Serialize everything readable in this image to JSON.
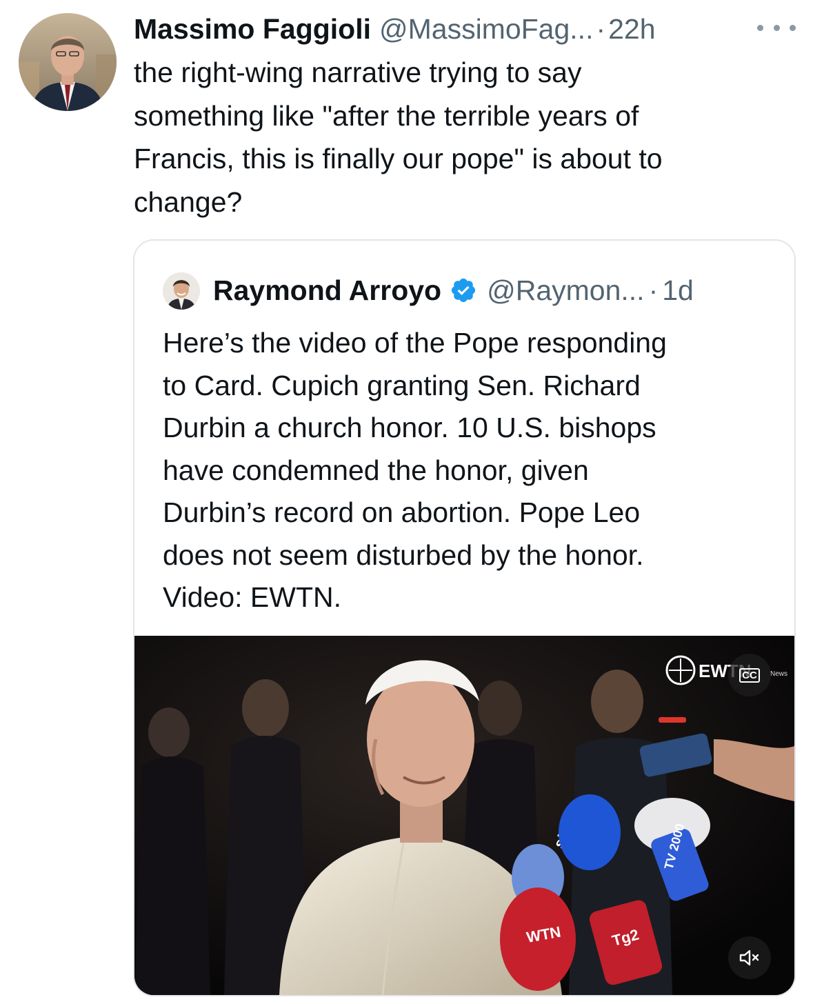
{
  "tweet": {
    "author": {
      "display_name": "Massimo Faggioli",
      "handle": "@MassimoFag...",
      "separator": "·",
      "time": "22h",
      "avatar_icon": "profile-photo"
    },
    "more_icon": "ellipsis-icon",
    "text": "the right-wing narrative trying to say\nsomething like \"after the terrible years of\nFrancis, this is finally our pope\" is about to\nchange?"
  },
  "quote": {
    "author": {
      "display_name": "Raymond Arroyo",
      "verified": true,
      "verified_color": "#1d9bf0",
      "handle": "@Raymon...",
      "separator": "·",
      "time": "1d",
      "avatar_icon": "profile-photo"
    },
    "text": "Here’s the video of the Pope responding\nto Card. Cupich granting Sen. Richard\nDurbin a church honor. 10 U.S. bishops\nhave condemned the honor, given\nDurbin’s record on abortion. Pope Leo\ndoes not seem disturbed by the honor.\nVideo: EWTN.",
    "video": {
      "watermark": "EWTN",
      "watermark_sub": "News",
      "mic_labels": [
        "sky",
        "TV 2000",
        "WTN",
        "Tg2"
      ],
      "cc_label": "CC",
      "mute_icon": "speaker-muted-icon"
    }
  }
}
